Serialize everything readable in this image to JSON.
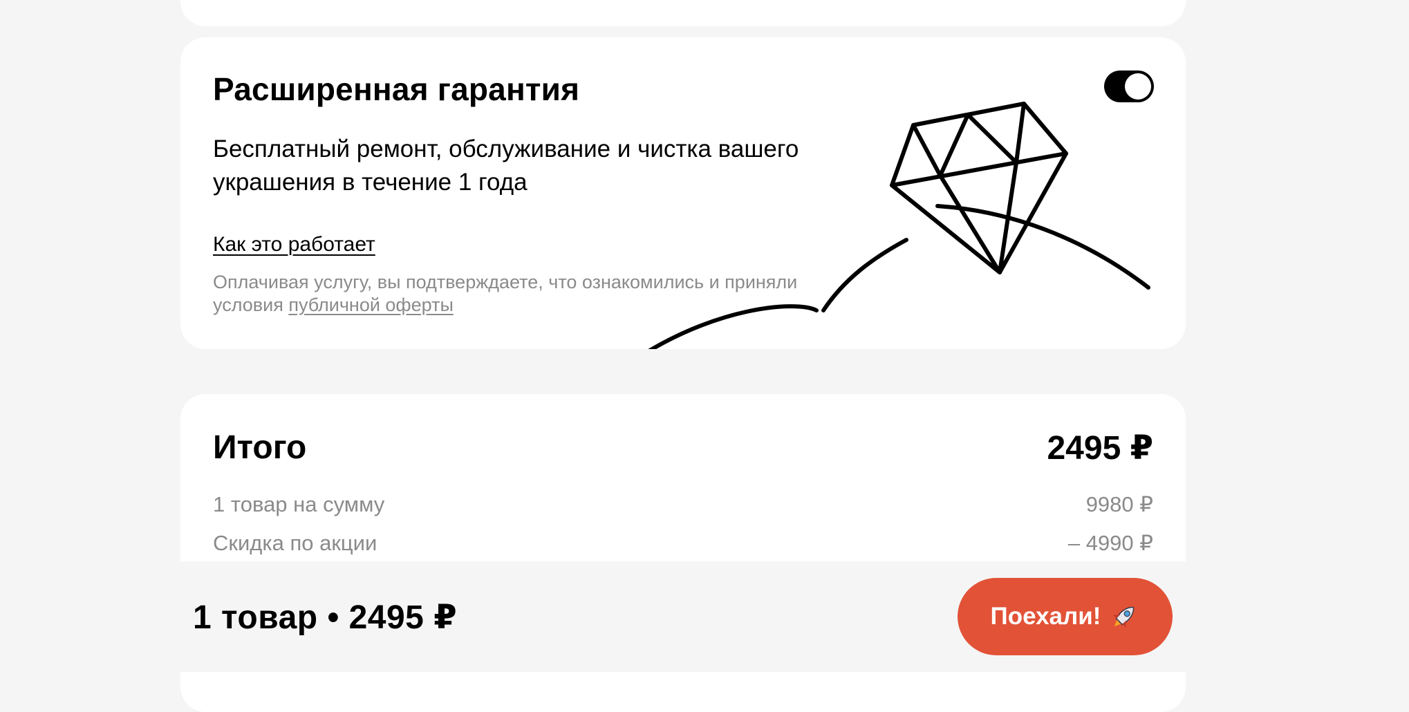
{
  "warranty": {
    "title": "Расширенная гарантия",
    "description": "Бесплатный ремонт, обслуживание и чистка вашего украшения в течение 1 года",
    "how_it_works_link": "Как это работает",
    "terms_prefix": "Оплачивая услугу, вы подтверждаете, что ознакомились и приняли условия ",
    "terms_link": "публичной оферты",
    "toggle_on": true,
    "illustration_icon": "diamond-ring-icon"
  },
  "total": {
    "title": "Итого",
    "amount": "2495 ₽",
    "rows": [
      {
        "label": "1 товар на сумму",
        "value": "9980 ₽"
      },
      {
        "label": "Скидка по акции",
        "value": "– 4990 ₽"
      }
    ]
  },
  "bottom_bar": {
    "summary": "1 товар • 2495 ₽",
    "button_label": "Поехали!",
    "button_icon": "rocket-icon",
    "button_color": "#e25237"
  }
}
